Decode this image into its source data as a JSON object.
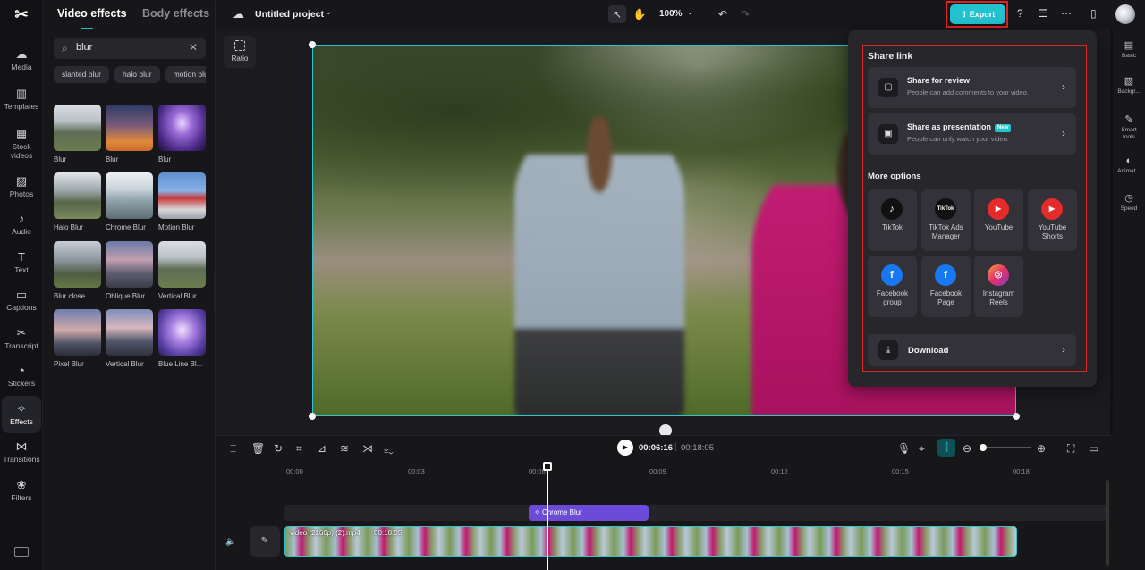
{
  "rail": {
    "items": [
      {
        "label": "Media",
        "icon": "☁"
      },
      {
        "label": "Templates",
        "icon": "▥"
      },
      {
        "label": "Stock videos",
        "icon": "▦"
      },
      {
        "label": "Photos",
        "icon": "▨"
      },
      {
        "label": "Audio",
        "icon": "♪"
      },
      {
        "label": "Text",
        "icon": "T"
      },
      {
        "label": "Captions",
        "icon": "▭"
      },
      {
        "label": "Transcript",
        "icon": "✂"
      },
      {
        "label": "Stickers",
        "icon": "◔"
      },
      {
        "label": "Effects",
        "icon": "✧"
      },
      {
        "label": "Transitions",
        "icon": "⋈"
      },
      {
        "label": "Filters",
        "icon": "❀"
      }
    ]
  },
  "effects_panel": {
    "tab_video": "Video effects",
    "tab_body": "Body effects",
    "search_value": "blur",
    "chips": [
      "slanted blur",
      "halo blur",
      "motion blur"
    ],
    "effects": [
      {
        "label": "Blur"
      },
      {
        "label": "Blur"
      },
      {
        "label": "Blur"
      },
      {
        "label": "Halo Blur"
      },
      {
        "label": "Chrome Blur"
      },
      {
        "label": "Motion Blur"
      },
      {
        "label": "Blur close"
      },
      {
        "label": "Oblique Blur"
      },
      {
        "label": "Vertical Blur"
      },
      {
        "label": "Pixel Blur"
      },
      {
        "label": "Vertical Blur"
      },
      {
        "label": "Blue Line Bl..."
      }
    ]
  },
  "topbar": {
    "project_title": "Untitled project",
    "zoom": "100%",
    "export_label": "Export"
  },
  "canvas": {
    "ratio_label": "Ratio"
  },
  "share": {
    "share_link_title": "Share link",
    "review_title": "Share for review",
    "review_sub": "People can add comments to your video.",
    "presentation_title": "Share as presentation",
    "presentation_badge": "New",
    "presentation_sub": "People can only watch your video.",
    "more_options_title": "More options",
    "platforms": [
      {
        "label": "TikTok",
        "glyph": "♪"
      },
      {
        "label": "TikTok Ads Manager",
        "glyph": "TikTok"
      },
      {
        "label": "YouTube",
        "glyph": "▶"
      },
      {
        "label": "YouTube Shorts",
        "glyph": "▶"
      },
      {
        "label": "Facebook group",
        "glyph": "f"
      },
      {
        "label": "Facebook Page",
        "glyph": "f"
      },
      {
        "label": "Instagram Reels",
        "glyph": "◎"
      }
    ],
    "download_label": "Download"
  },
  "props": {
    "items": [
      {
        "label": "Basic",
        "icon": "▤"
      },
      {
        "label": "Backgr...",
        "icon": "▧"
      },
      {
        "label": "Smart tools",
        "icon": "✎"
      },
      {
        "label": "Animat...",
        "icon": "◐"
      },
      {
        "label": "Speed",
        "icon": "◷"
      }
    ]
  },
  "timeline": {
    "current_time": "00:06:16",
    "total_time": "00:18:05",
    "ruler": [
      "00:00",
      "00:03",
      "00:06",
      "00:09",
      "00:12",
      "00:15",
      "00:18"
    ],
    "effect_clip_label": "Chrome Blur",
    "video_clip_name": "video (2160p) (2).mp4",
    "video_clip_duration": "00:18:05"
  },
  "colors": {
    "accent": "#22c2d0",
    "highlight": "#e02424",
    "effect_clip": "#6b4bd8"
  }
}
